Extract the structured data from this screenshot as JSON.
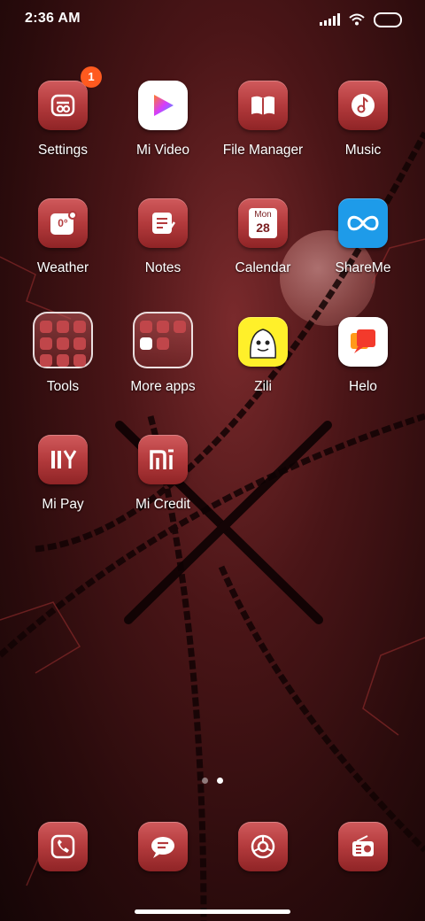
{
  "status_bar": {
    "time": "2:36 AM"
  },
  "apps": {
    "settings": {
      "label": "Settings",
      "badge": "1"
    },
    "mi_video": {
      "label": "Mi Video"
    },
    "file_manager": {
      "label": "File Manager"
    },
    "music": {
      "label": "Music"
    },
    "weather": {
      "label": "Weather",
      "temp": "0°"
    },
    "notes": {
      "label": "Notes"
    },
    "calendar": {
      "label": "Calendar",
      "day": "Mon",
      "date": "28"
    },
    "shareme": {
      "label": "ShareMe"
    },
    "tools": {
      "label": "Tools"
    },
    "more_apps": {
      "label": "More apps"
    },
    "zili": {
      "label": "Zili"
    },
    "helo": {
      "label": "Helo"
    },
    "mi_pay": {
      "label": "Mi Pay"
    },
    "mi_credit": {
      "label": "Mi Credit"
    }
  },
  "page_indicator": {
    "pages": 2,
    "current": 2
  },
  "dock": [
    "phone-icon",
    "messages-icon",
    "browser-icon",
    "radio-icon"
  ],
  "colors": {
    "icon_red": "#b33a3c",
    "badge": "#ff5a1f",
    "shareme_blue": "#1e9be9",
    "zili_yellow": "#fff02a",
    "helo_red": "#f33a2c"
  }
}
